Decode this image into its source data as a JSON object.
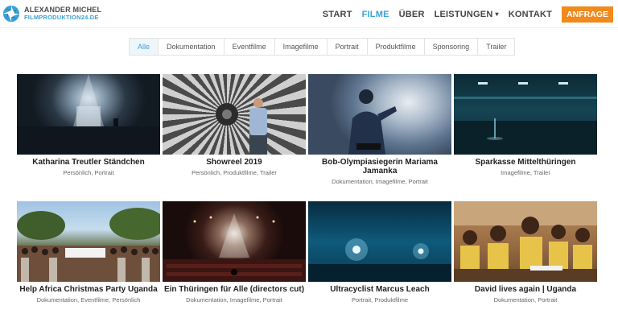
{
  "brand": {
    "line1": "ALEXANDER MICHEL",
    "line2": "FILMPRODUKTION24.DE"
  },
  "nav": {
    "items": [
      {
        "label": "START",
        "active": false
      },
      {
        "label": "FILME",
        "active": true
      },
      {
        "label": "ÜBER",
        "active": false
      },
      {
        "label": "LEISTUNGEN",
        "active": false,
        "has_dropdown": true
      },
      {
        "label": "KONTAKT",
        "active": false
      }
    ],
    "cta_label": "ANFRAGE",
    "chevron": "▾"
  },
  "filters": [
    {
      "label": "Alle",
      "active": true
    },
    {
      "label": "Dokumentation",
      "active": false
    },
    {
      "label": "Eventfilme",
      "active": false
    },
    {
      "label": "Imagefilme",
      "active": false
    },
    {
      "label": "Portrait",
      "active": false
    },
    {
      "label": "Produktfilme",
      "active": false
    },
    {
      "label": "Sponsoring",
      "active": false
    },
    {
      "label": "Trailer",
      "active": false
    }
  ],
  "films": [
    {
      "title": "Katharina Treutler Ständchen",
      "categories": "Persönlich, Portrait"
    },
    {
      "title": "Showreel 2019",
      "categories": "Persönlich, Produktfilme, Trailer"
    },
    {
      "title": "Bob-Olympiasiegerin Mariama Jamanka",
      "categories": "Dokumentation, Imagefilme, Portrait"
    },
    {
      "title": "Sparkasse Mittelthüringen",
      "categories": "Imagefilme, Trailer"
    },
    {
      "title": "Help Africa Christmas Party Uganda",
      "categories": "Dokumentation, Eventfilme, Persönlich"
    },
    {
      "title": "Ein Thüringen für Alle (directors cut)",
      "categories": "Dokumentation, Imagefilme, Portrait"
    },
    {
      "title": "Ultracyclist Marcus Leach",
      "categories": "Portrait, Produktfilme"
    },
    {
      "title": "David lives again | Uganda",
      "categories": "Dokumentation, Portrait"
    }
  ],
  "colors": {
    "accent": "#3aa2d6",
    "cta": "#f08a1c"
  }
}
